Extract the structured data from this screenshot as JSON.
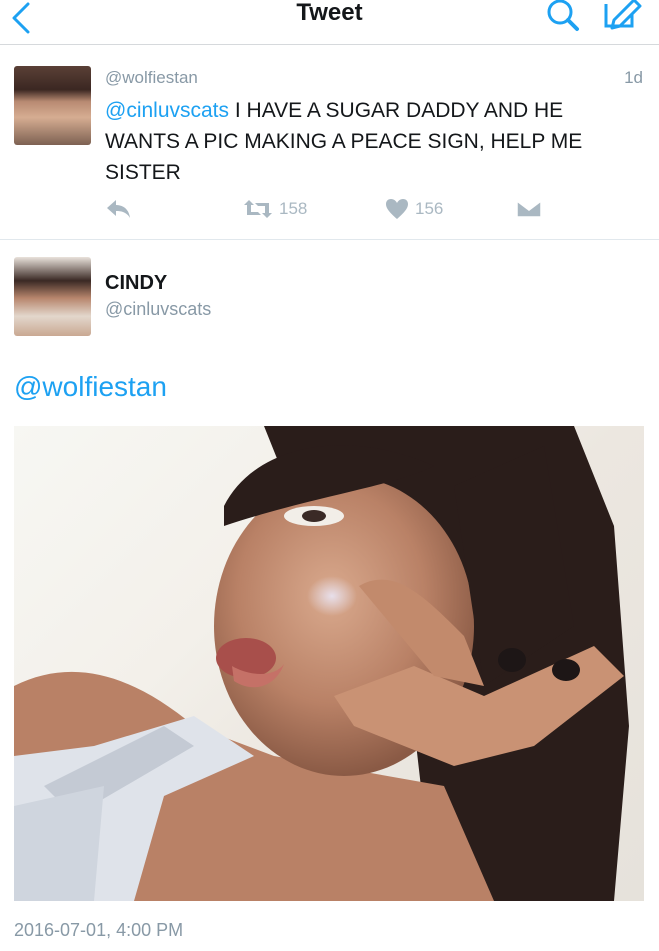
{
  "nav": {
    "title": "Tweet",
    "back_icon": "chevron-left-icon",
    "search_icon": "search-icon",
    "compose_icon": "compose-icon",
    "accent": "#1da1f2"
  },
  "tweet": {
    "handle": "@wolfiestan",
    "time": "1d",
    "mention": "@cinluvscats",
    "text": " I HAVE A SUGAR DADDY AND HE WANTS A PIC MAKING A PEACE SIGN, HELP ME SISTER",
    "retweets": "158",
    "likes": "156"
  },
  "reply": {
    "name": "CINDY",
    "handle": "@cinluvscats",
    "text": "@wolfiestan",
    "timestamp": "2016-07-01, 4:00 PM"
  }
}
